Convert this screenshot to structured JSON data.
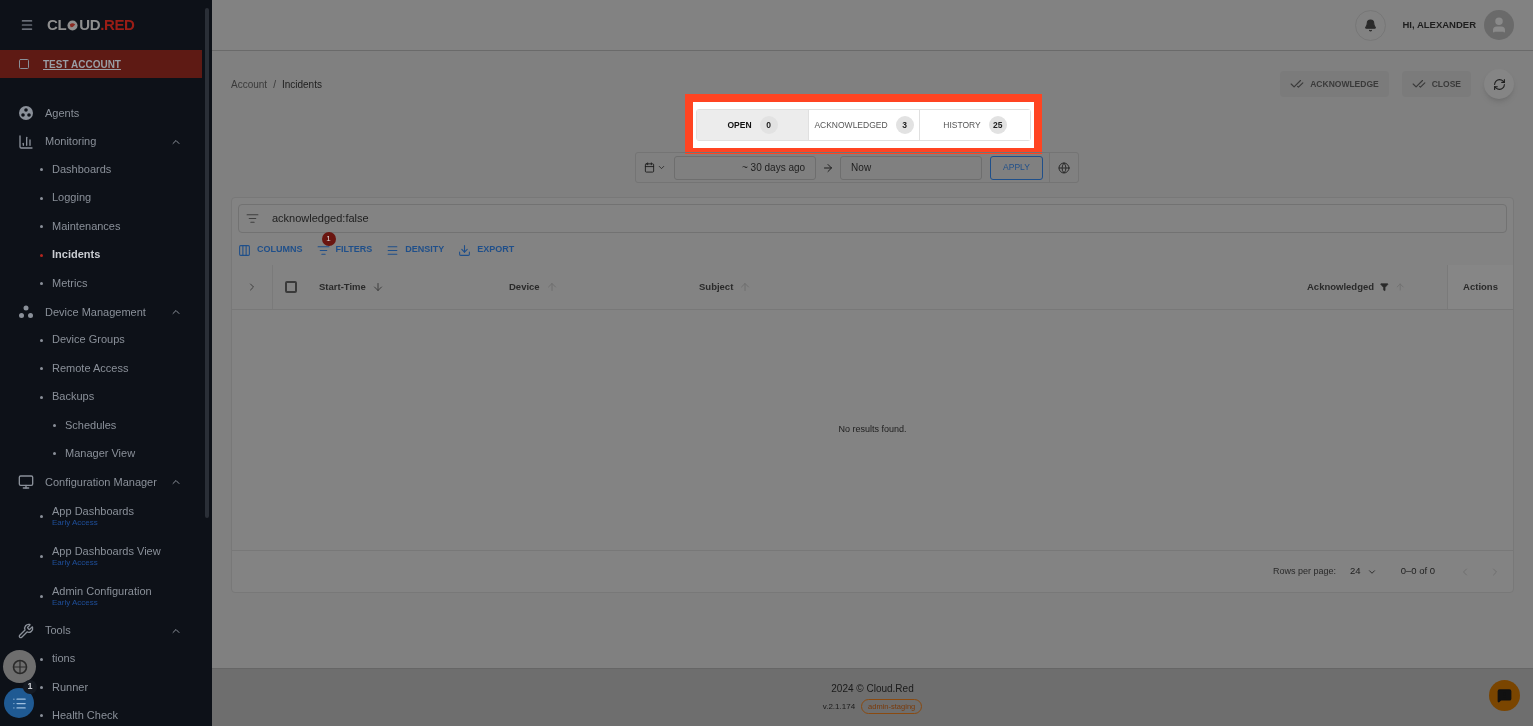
{
  "sidebar": {
    "logo": {
      "left": "CL",
      "right": "UD",
      "suffix": ".RED"
    },
    "account": "TEST ACCOUNT",
    "items": [
      {
        "label": "Agents",
        "selected": false
      },
      {
        "label": "Monitoring",
        "selected": false,
        "expanded": true,
        "children": [
          {
            "label": "Dashboards",
            "selected": false
          },
          {
            "label": "Logging",
            "selected": false
          },
          {
            "label": "Maintenances",
            "selected": false
          },
          {
            "label": "Incidents",
            "selected": true
          },
          {
            "label": "Metrics",
            "selected": false
          }
        ]
      },
      {
        "label": "Device Management",
        "selected": false,
        "expanded": true,
        "children": [
          {
            "label": "Device Groups",
            "selected": false
          },
          {
            "label": "Remote Access",
            "selected": false
          },
          {
            "label": "Backups",
            "selected": false,
            "children": [
              {
                "label": "Schedules",
                "selected": false
              },
              {
                "label": "Manager View",
                "selected": false
              }
            ]
          }
        ]
      },
      {
        "label": "Configuration Manager",
        "selected": false,
        "expanded": true,
        "children": [
          {
            "label": "App Dashboards",
            "badge": "Early Access",
            "selected": false
          },
          {
            "label": "App Dashboards View",
            "badge": "Early Access",
            "selected": false
          },
          {
            "label": "Admin Configuration",
            "badge": "Early Access",
            "selected": false
          }
        ]
      },
      {
        "label": "Tools",
        "selected": false,
        "expanded": true,
        "children": [
          {
            "label": "tions",
            "selected": false
          },
          {
            "label": "Runner",
            "selected": false
          },
          {
            "label": "Health Check",
            "selected": false
          }
        ]
      }
    ],
    "widget": {
      "count": "1"
    }
  },
  "header": {
    "greeting": "HI, ALEXANDER"
  },
  "breadcrumbs": {
    "separator": "/",
    "items": [
      "Account",
      "Incidents"
    ]
  },
  "actions": [
    {
      "label": "ACKNOWLEDGE",
      "disabled": true
    },
    {
      "label": "CLOSE",
      "disabled": true
    }
  ],
  "tabs": [
    {
      "label": "OPEN",
      "count": "0",
      "selected": true
    },
    {
      "label": "ACKNOWLEDGED",
      "count": "3",
      "selected": false
    },
    {
      "label": "HISTORY",
      "count": "25",
      "selected": false
    }
  ],
  "date_range": {
    "from": "~ 30 days ago",
    "to": "Now",
    "apply": "APPLY"
  },
  "table": {
    "filter": "acknowledged:false",
    "select_all": {
      "checked": false
    },
    "toolbar": [
      {
        "kind": "columns",
        "label": "COLUMNS"
      },
      {
        "kind": "filters",
        "label": "FILTERS",
        "badge": "1"
      },
      {
        "kind": "density",
        "label": "DENSITY"
      },
      {
        "kind": "export",
        "label": "EXPORT"
      }
    ],
    "columns": [
      {
        "label": "Start-Time",
        "sorted": true,
        "filtered": false
      },
      {
        "label": "Device",
        "sorted": false,
        "filtered": false
      },
      {
        "label": "Subject",
        "sorted": false,
        "filtered": false
      },
      {
        "label": "Acknowledged",
        "sorted": false,
        "filtered": true
      },
      {
        "label": "Actions"
      }
    ],
    "empty": "No results found.",
    "pagination": {
      "rows_label": "Rows per page:",
      "rows": "24",
      "range": "0–0 of 0"
    }
  },
  "footer": {
    "copyright": "2024  © Cloud.Red",
    "version": "v.2.1.174",
    "env": "admin-staging"
  }
}
